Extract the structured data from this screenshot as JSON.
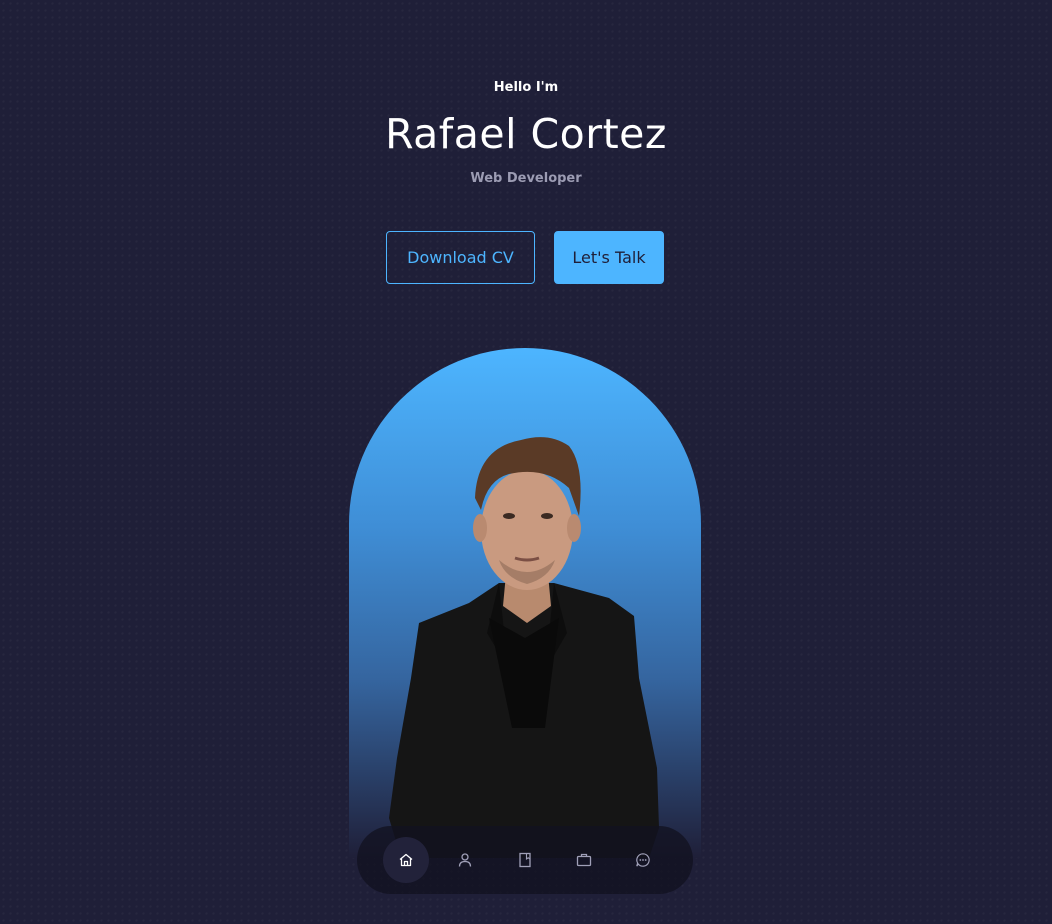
{
  "hero": {
    "greeting": "Hello I'm",
    "name": "Rafael Cortez",
    "role": "Web Developer"
  },
  "cta": {
    "download_label": "Download CV",
    "talk_label": "Let's Talk"
  },
  "nav": {
    "items": [
      {
        "icon": "home-icon",
        "active": true
      },
      {
        "icon": "user-icon",
        "active": false
      },
      {
        "icon": "book-icon",
        "active": false
      },
      {
        "icon": "briefcase-icon",
        "active": false
      },
      {
        "icon": "chat-icon",
        "active": false
      }
    ]
  },
  "colors": {
    "background": "#1f1f38",
    "accent": "#4db5ff",
    "muted_text": "#9c9cb3"
  }
}
